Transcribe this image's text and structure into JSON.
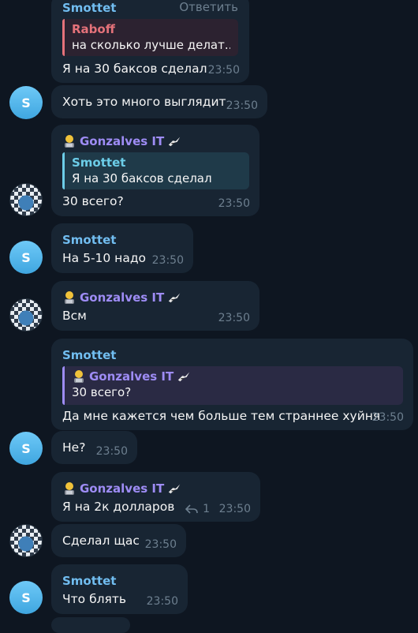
{
  "colors": {
    "background": "#0e1621",
    "bubble": "#182533",
    "smottet": "#71bdf0",
    "gonzalves": "#9e8cf5",
    "raboff": "#e5727a",
    "time": "#6d7f8f"
  },
  "messages": {
    "m1": {
      "sender": "Smottet",
      "reply_action": "Ответить",
      "quote_sender": "Raboff",
      "quote_text": "на сколько лучше делат...",
      "text": "Я на 30 баксов сделал",
      "time": "23:50"
    },
    "m2": {
      "avatar": "S",
      "text": "Хоть это много выглядит",
      "time": "23:50"
    },
    "m3": {
      "sender": "Gonzalves IT",
      "quote_sender": "Smottet",
      "quote_text": "Я на 30 баксов сделал",
      "text": "30 всего?",
      "time": "23:50"
    },
    "m4": {
      "avatar": "S",
      "sender": "Smottet",
      "text": "На 5-10 надо",
      "time": "23:50"
    },
    "m5": {
      "sender": "Gonzalves IT",
      "text": "Всм",
      "time": "23:50"
    },
    "m6": {
      "sender": "Smottet",
      "quote_sender": "Gonzalves IT",
      "quote_text": "30 всего?",
      "text": "Да мне кажется чем больше тем страннее хуйня",
      "time": "23:50"
    },
    "m7": {
      "avatar": "S",
      "text": "Не?",
      "time": "23:50"
    },
    "m8": {
      "sender": "Gonzalves IT",
      "text": "Я на 2к долларов",
      "reply_count": "1",
      "time": "23:50"
    },
    "m9": {
      "text": "Сделал щас",
      "time": "23:50"
    },
    "m10": {
      "avatar": "S",
      "sender": "Smottet",
      "text": "Что блять",
      "time": "23:50"
    }
  }
}
